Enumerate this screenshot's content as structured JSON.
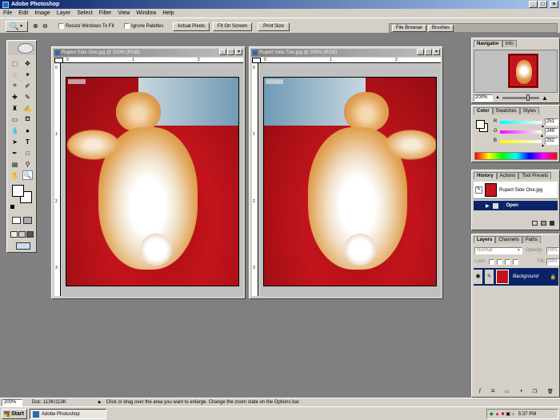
{
  "app_title": "Adobe Photoshop",
  "menu": [
    "File",
    "Edit",
    "Image",
    "Layer",
    "Select",
    "Filter",
    "View",
    "Window",
    "Help"
  ],
  "options": {
    "resize": "Resize Windows To Fit",
    "ignore": "Ignore Palettes",
    "actual": "Actual Pixels",
    "fit": "Fit On Screen",
    "print": "Print Size"
  },
  "palette_well": [
    "File Browser",
    "Brushes"
  ],
  "docs": [
    {
      "title": "Rupert Side One.jpg @ 200% (RGB)"
    },
    {
      "title": "Rupert Side Two.jpg @ 200% (RGB)"
    }
  ],
  "ruler_h": [
    "0",
    "1",
    "2"
  ],
  "ruler_v": [
    "0",
    "1",
    "2",
    "3"
  ],
  "navigator": {
    "tabs": [
      "Navigator",
      "Info"
    ],
    "zoom": "200%"
  },
  "color": {
    "tabs": [
      "Color",
      "Swatches",
      "Styles"
    ],
    "r_label": "R",
    "g_label": "G",
    "b_label": "B",
    "r": "251",
    "g": "249",
    "b": "252",
    "r_level": 0.98,
    "g_level": 0.98,
    "b_level": 0.99
  },
  "history": {
    "tabs": [
      "History",
      "Actions",
      "Tool Presets"
    ],
    "source": "Rupert Side One.jpg",
    "step": "Open"
  },
  "layers": {
    "tabs": [
      "Layers",
      "Channels",
      "Paths"
    ],
    "mode": "Normal",
    "opacity_label": "Opacity:",
    "opacity": "100%",
    "lock_label": "Lock:",
    "fill_label": "Fill:",
    "fill": "100%",
    "layer_name": "Background"
  },
  "status": {
    "zoom": "200%",
    "doc": "Doc: 113K/113K",
    "hint": "Click or drag over the area you want to enlarge. Change the zoom state on the Options bar."
  },
  "taskbar": {
    "start": "Start",
    "task": "Adobe Photoshop",
    "time": "5:37 PM"
  },
  "colors": {
    "title_active": "#0a246a",
    "title_end": "#a6caf0",
    "workspace": "#808080",
    "chrome": "#d4d0c8",
    "photo_red": "#c3141c",
    "history_sel": "#0a246a"
  }
}
